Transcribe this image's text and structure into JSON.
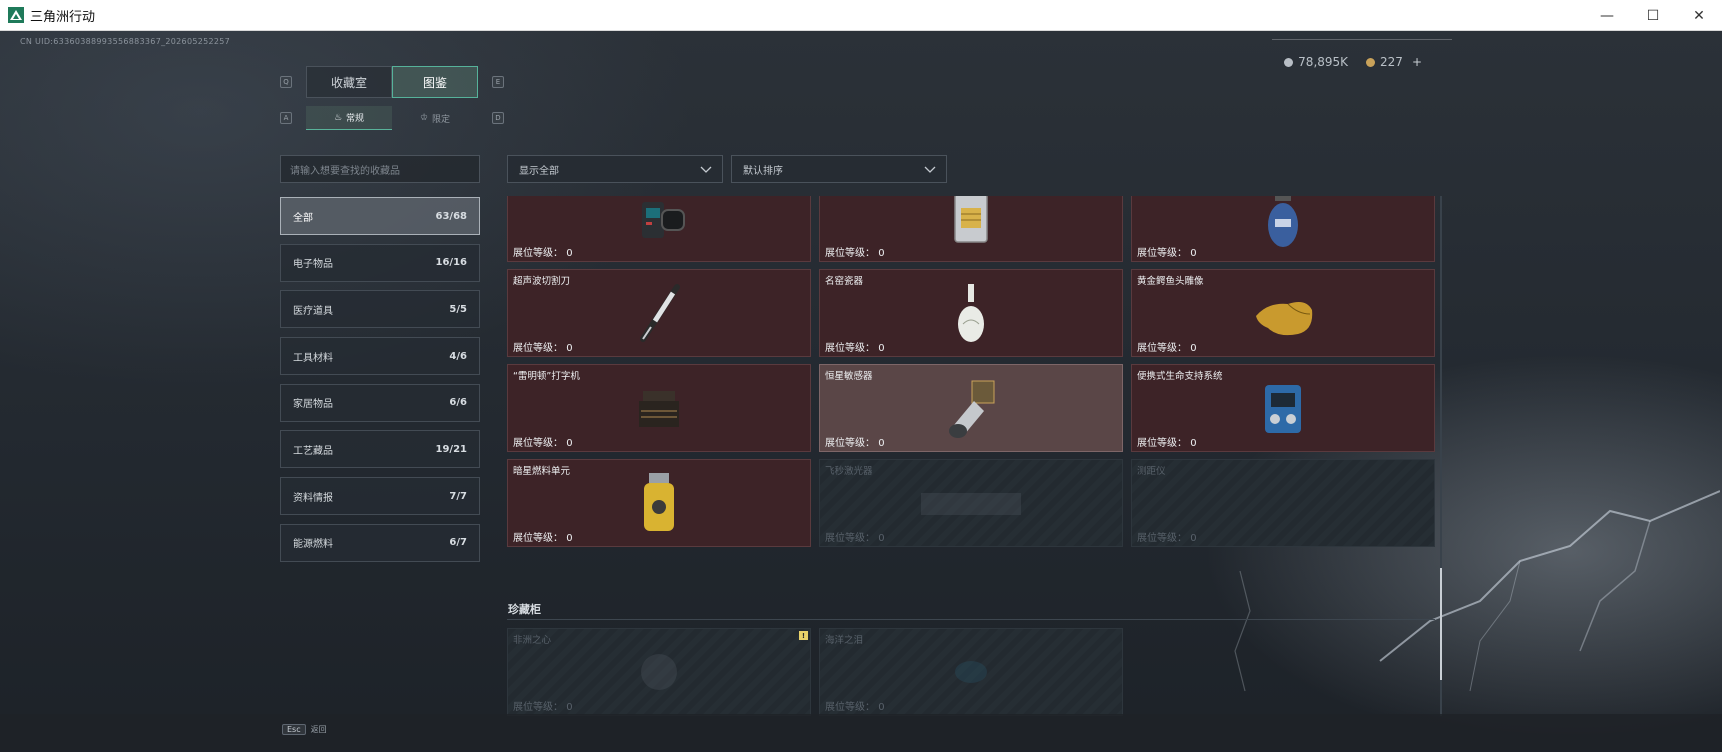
{
  "window": {
    "title": "三角洲行动",
    "buttons": {
      "minimize": "—",
      "maximize": "☐",
      "close": "✕"
    }
  },
  "header": {
    "uid": "CN UID:63360388993556883367_202605252257",
    "currency": [
      {
        "icon": "silver-coin-icon",
        "value": "78,895K"
      },
      {
        "icon": "gold-coin-icon",
        "value": "227"
      }
    ],
    "plus": "+"
  },
  "tabs": [
    {
      "label": "收藏室",
      "active": false
    },
    {
      "label": "图鉴",
      "active": true
    }
  ],
  "tab_keys": {
    "left": "Q",
    "right": "E"
  },
  "subtabs": [
    {
      "label": "常规",
      "icon": "flame-icon",
      "active": true
    },
    {
      "label": "限定",
      "icon": "crown-icon",
      "active": false
    }
  ],
  "subtab_keys": {
    "left": "A",
    "right": "D"
  },
  "search": {
    "placeholder": "请输入想要查找的收藏品"
  },
  "categories": [
    {
      "label": "全部",
      "count": "63/68",
      "active": true
    },
    {
      "label": "电子物品",
      "count": "16/16"
    },
    {
      "label": "医疗道具",
      "count": "5/5"
    },
    {
      "label": "工具材料",
      "count": "4/6"
    },
    {
      "label": "家居物品",
      "count": "6/6"
    },
    {
      "label": "工艺藏品",
      "count": "19/21"
    },
    {
      "label": "资料情报",
      "count": "7/7"
    },
    {
      "label": "能源燃料",
      "count": "6/7"
    }
  ],
  "filters": {
    "show": "显示全部",
    "sort": "默认排序"
  },
  "level_label": "展位等级：",
  "items": [
    {
      "name": "",
      "level": "0",
      "icon": "device-icon",
      "state": "owned"
    },
    {
      "name": "",
      "level": "0",
      "icon": "reactor-core-icon",
      "state": "owned"
    },
    {
      "name": "",
      "level": "0",
      "icon": "gas-canister-icon",
      "state": "owned"
    },
    {
      "name": "超声波切割刀",
      "level": "0",
      "icon": "cutting-knife-icon",
      "state": "owned"
    },
    {
      "name": "名窑瓷器",
      "level": "0",
      "icon": "porcelain-vase-icon",
      "state": "owned"
    },
    {
      "name": "黄金鳄鱼头雕像",
      "level": "0",
      "icon": "gold-crocodile-icon",
      "state": "owned"
    },
    {
      "name": "“雷明顿”打字机",
      "level": "0",
      "icon": "typewriter-icon",
      "state": "owned"
    },
    {
      "name": "恒星敏感器",
      "level": "0",
      "icon": "star-sensor-icon",
      "state": "selected"
    },
    {
      "name": "便携式生命支持系统",
      "level": "0",
      "icon": "life-support-icon",
      "state": "owned"
    },
    {
      "name": "暗星燃料单元",
      "level": "0",
      "icon": "fuel-cell-icon",
      "state": "owned"
    },
    {
      "name": "飞秒激光器",
      "level": "0",
      "icon": "laser-icon",
      "state": "locked"
    },
    {
      "name": "测距仪",
      "level": "0",
      "icon": "rangefinder-icon",
      "state": "locked"
    }
  ],
  "treasure": {
    "title": "珍藏柜",
    "items": [
      {
        "name": "非洲之心",
        "level": "0",
        "icon": "diamond-icon",
        "state": "locked",
        "badge": "!"
      },
      {
        "name": "海洋之泪",
        "level": "0",
        "icon": "gem-icon",
        "state": "locked"
      }
    ]
  },
  "bottom": {
    "esc_key": "Esc",
    "esc_label": "返回"
  },
  "colors": {
    "accent": "#56b29a",
    "card_owned": "#3d2327",
    "card_selected": "#5a4647",
    "card_locked": "#232a30"
  }
}
